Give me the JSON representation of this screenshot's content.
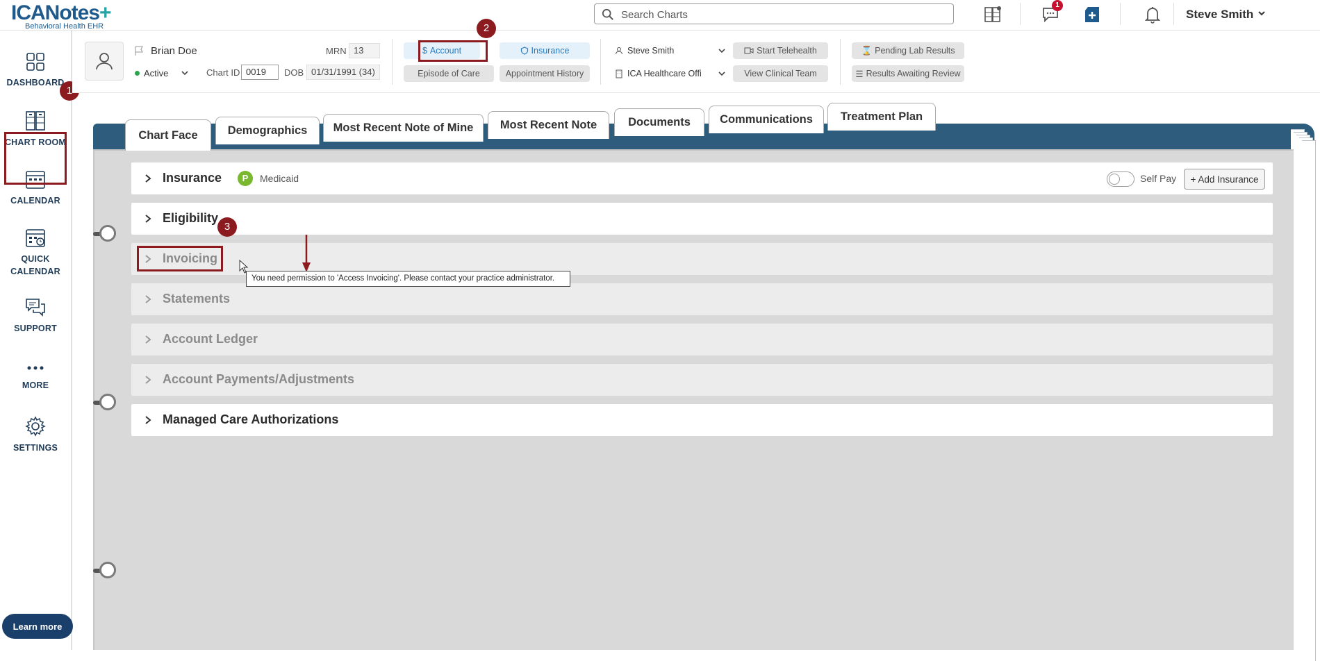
{
  "app": {
    "logo_main": "ICANotes",
    "logo_plus": "+",
    "logo_sub": "Behavioral Health EHR"
  },
  "topbar": {
    "search_placeholder": "Search Charts",
    "messages_badge": "1",
    "user_name": "Steve Smith"
  },
  "sidebar": {
    "items": [
      {
        "label": "DASHBOARD",
        "icon": "dashboard-icon"
      },
      {
        "label": "CHART ROOM",
        "icon": "chart-room-icon"
      },
      {
        "label": "CALENDAR",
        "icon": "calendar-icon"
      },
      {
        "label": "QUICK\nCALENDAR",
        "line1": "QUICK",
        "line2": "CALENDAR",
        "icon": "quick-calendar-icon"
      },
      {
        "label": "SUPPORT",
        "icon": "support-icon"
      },
      {
        "label": "MORE",
        "icon": "more-icon"
      },
      {
        "label": "SETTINGS",
        "icon": "gear-icon"
      }
    ],
    "learn_more": "Learn more"
  },
  "steps": {
    "one": "1",
    "two": "2",
    "three": "3"
  },
  "patient": {
    "name": "Brian Doe",
    "status": "Active",
    "mrn_label": "MRN",
    "mrn": "13",
    "chart_id_label": "Chart ID",
    "chart_id": "0019",
    "dob_label": "DOB",
    "dob": "01/31/1991 (34)"
  },
  "patient_buttons": {
    "account": "Account",
    "insurance": "Insurance",
    "episode": "Episode of Care",
    "appointment_history": "Appointment History",
    "provider": "Steve Smith",
    "office": "ICA Healthcare Offi",
    "start_telehealth": "Start Telehealth",
    "view_clinical_team": "View Clinical Team",
    "pending_lab": "Pending Lab Results",
    "results_awaiting": "Results Awaiting Review"
  },
  "tabs": [
    "Chart Face",
    "Demographics",
    "Most Recent Note of Mine",
    "Most Recent Note",
    "Documents",
    "Communications",
    "Treatment Plan"
  ],
  "sections": {
    "insurance": "Insurance",
    "medicaid_badge": "P",
    "medicaid": "Medicaid",
    "self_pay": "Self Pay",
    "add_insurance": "+ Add Insurance",
    "eligibility": "Eligibility",
    "invoicing": "Invoicing",
    "statements": "Statements",
    "account_ledger": "Account Ledger",
    "account_payments": "Account Payments/Adjustments",
    "managed_care": "Managed Care Authorizations"
  },
  "tooltip": {
    "text": "You need permission to 'Access Invoicing'. Please contact your practice administrator."
  },
  "colors": {
    "brand": "#1e5a8c",
    "binder": "#2d5c7c",
    "highlight": "#8b1b1e",
    "accent_blue": "#2a7bbf"
  }
}
